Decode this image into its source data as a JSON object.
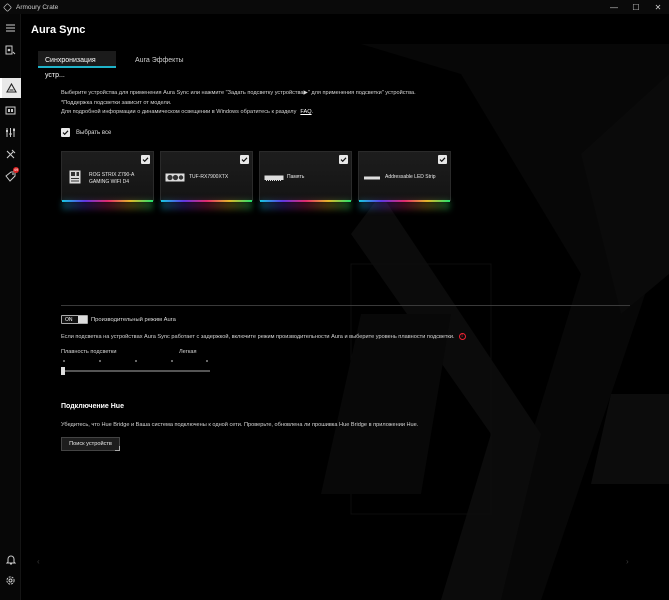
{
  "window": {
    "app_title": "Armoury Crate",
    "minimize": "—",
    "maximize": "☐",
    "close": "✕"
  },
  "sidebar": {
    "items": [
      {
        "name": "menu-icon"
      },
      {
        "name": "device-icon"
      },
      {
        "name": "aura-sync-icon",
        "active": true
      },
      {
        "name": "gamevisual-icon"
      },
      {
        "name": "scenario-profiles-icon"
      },
      {
        "name": "tools-icon"
      },
      {
        "name": "deals-icon",
        "badge": "49"
      }
    ],
    "bottom": [
      {
        "name": "notification-icon"
      },
      {
        "name": "settings-icon"
      }
    ]
  },
  "page": {
    "title": "Aura Sync"
  },
  "tabs": [
    {
      "label": "Синхронизация устр...",
      "active": true
    },
    {
      "label": "Aura Эффекты",
      "active": false
    }
  ],
  "description": {
    "line1": "Выберите устройства для применения Aura Sync или нажмите \"Задать подсветку устройства▶\" для применения подсветки\" устройства.",
    "line2": "*Поддержка подсветки зависит от модели.",
    "line3": "Для подробной информации о динамическом освещении в Windows обратитесь к разделу",
    "faq": "FAQ",
    "line3_end": "."
  },
  "select_all": {
    "label": "Выбрать все",
    "checked": true
  },
  "devices": [
    {
      "name": "ROG STRIX Z790-A GAMING WIFI D4",
      "icon": "motherboard-icon",
      "checked": true
    },
    {
      "name": "TUF-RX7900XTX",
      "icon": "graphics-card-icon",
      "checked": true
    },
    {
      "name": "Память",
      "icon": "memory-icon",
      "checked": true
    },
    {
      "name": "Addressable LED Strip",
      "icon": "led-strip-icon",
      "checked": true
    }
  ],
  "performance": {
    "toggle_state": "ON",
    "label": "Производительный режим Aura",
    "description": "Если подсветка на устройствах Aura Sync работает с задержкой, включите режим производительности Aura и выберите уровень плавности подсветки.",
    "info": "!"
  },
  "smoothness": {
    "label": "Плавность подсветки",
    "value": "Легкая",
    "level": 0
  },
  "hue": {
    "title": "Подключение Hue",
    "description": "Убедитесь, что Hue Bridge и Ваша система подключены к одной сети. Проверьте, обновлена ли прошивка Hue Bridge в приложении Hue.",
    "button": "Поиск устройств"
  },
  "colors": {
    "accent": "#1fb3c9",
    "background": "#000000",
    "badge": "#dd2222"
  }
}
